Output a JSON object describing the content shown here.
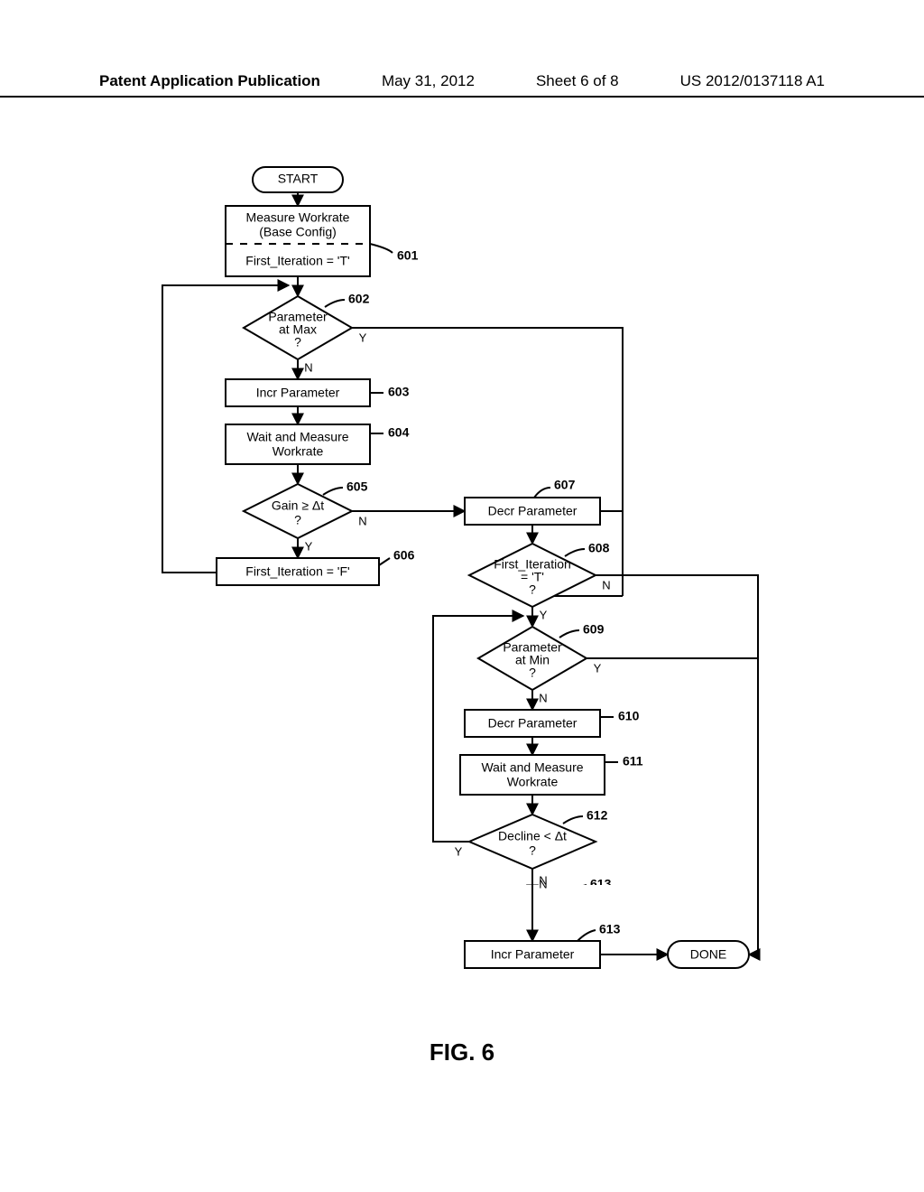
{
  "header": {
    "left": "Patent Application Publication",
    "date": "May 31, 2012",
    "sheet": "Sheet 6 of 8",
    "pubno": "US 2012/0137118 A1"
  },
  "caption": "FIG. 6",
  "nodes": {
    "start": "START",
    "b601a": "Measure Workrate\n(Base Config)",
    "b601b": "First_Iteration = 'T'",
    "d602": "Parameter\nat Max\n?",
    "b603": "Incr Parameter",
    "b604": "Wait and Measure\nWorkrate",
    "d605": "Gain ≥ Δt\n?",
    "b606": "First_Iteration = 'F'",
    "b607": "Decr Parameter",
    "d608": "First_Iteration\n= 'T'\n?",
    "d609": "Parameter\nat Min\n?",
    "b610": "Decr Parameter",
    "b611": "Wait and Measure\nWorkrate",
    "d612": "Decline < Δt\n?",
    "b613": "Incr Parameter",
    "done": "DONE"
  },
  "labels": {
    "l601": "601",
    "l602": "602",
    "l603": "603",
    "l604": "604",
    "l605": "605",
    "l606": "606",
    "l607": "607",
    "l608": "608",
    "l609": "609",
    "l610": "610",
    "l611": "611",
    "l612": "612",
    "l613": "613"
  },
  "yn": {
    "Y": "Y",
    "N": "N"
  }
}
